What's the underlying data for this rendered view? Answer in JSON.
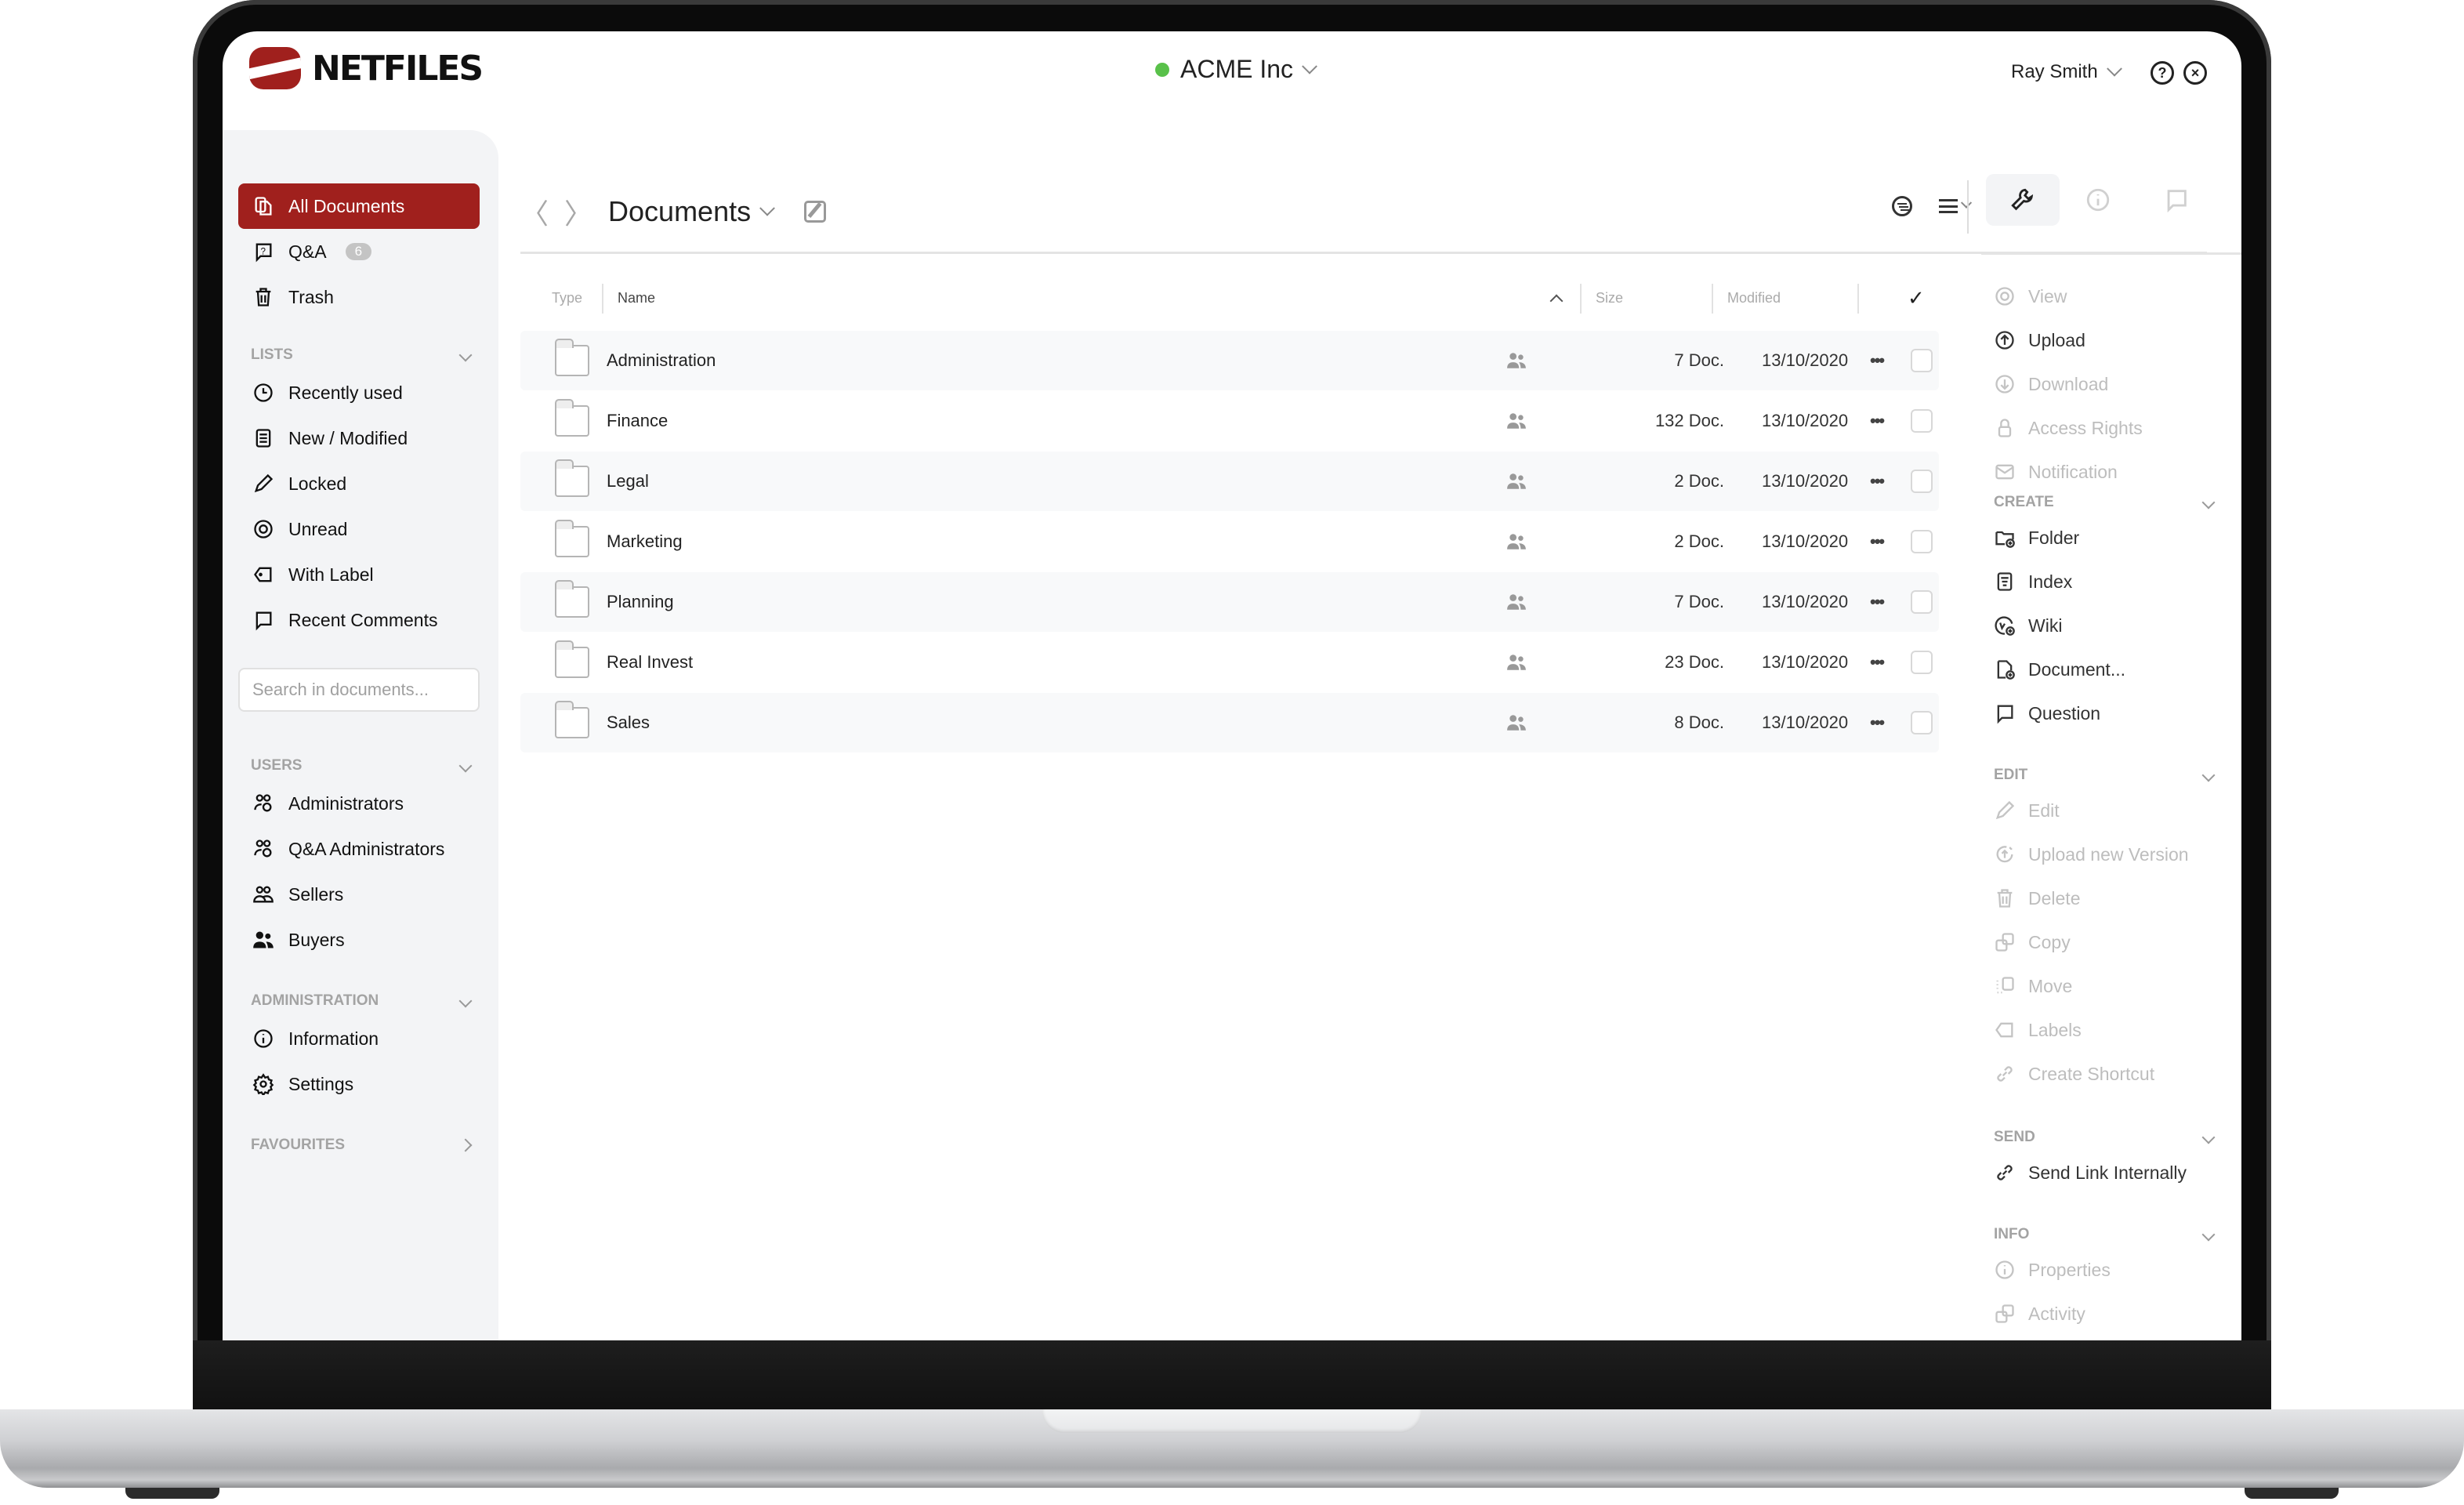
{
  "header": {
    "brand": "NETFILES",
    "organization": "ACME Inc",
    "organization_status_color": "#59c14a",
    "user": "Ray Smith",
    "help_icon": "help-circle-icon",
    "close_icon": "close-circle-icon"
  },
  "sidebar": {
    "top_items": [
      {
        "label": "All Documents",
        "icon": "documents-icon",
        "active": true
      },
      {
        "label": "Q&A",
        "icon": "question-bubble-icon",
        "badge": "6"
      },
      {
        "label": "Trash",
        "icon": "trash-icon"
      }
    ],
    "lists": {
      "title": "LISTS",
      "items": [
        {
          "label": "Recently used",
          "icon": "clock-icon"
        },
        {
          "label": "New / Modified",
          "icon": "document-lines-icon"
        },
        {
          "label": "Locked",
          "icon": "pencil-icon"
        },
        {
          "label": "Unread",
          "icon": "eye-icon"
        },
        {
          "label": "With Label",
          "icon": "tag-icon"
        },
        {
          "label": "Recent Comments",
          "icon": "comment-icon"
        }
      ]
    },
    "search_placeholder": "Search in documents...",
    "users": {
      "title": "USERS",
      "items": [
        {
          "label": "Administrators",
          "icon": "users-gear-icon"
        },
        {
          "label": "Q&A Administrators",
          "icon": "users-gear-icon"
        },
        {
          "label": "Sellers",
          "icon": "users-outline-icon"
        },
        {
          "label": "Buyers",
          "icon": "users-filled-icon"
        }
      ]
    },
    "administration": {
      "title": "ADMINISTRATION",
      "items": [
        {
          "label": "Information",
          "icon": "info-icon"
        },
        {
          "label": "Settings",
          "icon": "gear-icon"
        }
      ]
    },
    "favourites": {
      "title": "FAVOURITES"
    }
  },
  "main": {
    "title": "Documents",
    "columns": {
      "type": "Type",
      "name": "Name",
      "size": "Size",
      "modified": "Modified"
    },
    "rows": [
      {
        "name": "Administration",
        "size": "7 Doc.",
        "modified": "13/10/2020"
      },
      {
        "name": "Finance",
        "size": "132 Doc.",
        "modified": "13/10/2020"
      },
      {
        "name": "Legal",
        "size": "2 Doc.",
        "modified": "13/10/2020"
      },
      {
        "name": "Marketing",
        "size": "2 Doc.",
        "modified": "13/10/2020"
      },
      {
        "name": "Planning",
        "size": "7 Doc.",
        "modified": "13/10/2020"
      },
      {
        "name": "Real Invest",
        "size": "23 Doc.",
        "modified": "13/10/2020"
      },
      {
        "name": "Sales",
        "size": "8 Doc.",
        "modified": "13/10/2020"
      }
    ],
    "more_glyph": "•••"
  },
  "right_panel": {
    "tabs": [
      "tools",
      "info",
      "comments"
    ],
    "actions": [
      {
        "label": "View",
        "icon": "eye-icon",
        "enabled": false
      },
      {
        "label": "Upload",
        "icon": "upload-icon",
        "enabled": true
      },
      {
        "label": "Download",
        "icon": "download-icon",
        "enabled": false
      },
      {
        "label": "Access Rights",
        "icon": "lock-icon",
        "enabled": false
      },
      {
        "label": "Notification",
        "icon": "mail-icon",
        "enabled": false
      }
    ],
    "create": {
      "title": "CREATE",
      "items": [
        {
          "label": "Folder",
          "icon": "folder-plus-icon",
          "enabled": true
        },
        {
          "label": "Index",
          "icon": "index-icon",
          "enabled": true
        },
        {
          "label": "Wiki",
          "icon": "wiki-plus-icon",
          "enabled": true
        },
        {
          "label": "Document...",
          "icon": "document-plus-icon",
          "enabled": true
        },
        {
          "label": "Question",
          "icon": "comment-icon",
          "enabled": true
        }
      ]
    },
    "edit": {
      "title": "EDIT",
      "items": [
        {
          "label": "Edit",
          "icon": "pencil-icon",
          "enabled": false
        },
        {
          "label": "Upload new Version",
          "icon": "upload-version-icon",
          "enabled": false
        },
        {
          "label": "Delete",
          "icon": "trash-icon",
          "enabled": false
        },
        {
          "label": "Copy",
          "icon": "copy-icon",
          "enabled": false
        },
        {
          "label": "Move",
          "icon": "move-icon",
          "enabled": false
        },
        {
          "label": "Labels",
          "icon": "tag-icon",
          "enabled": false
        },
        {
          "label": "Create Shortcut",
          "icon": "link-icon",
          "enabled": false
        }
      ]
    },
    "send": {
      "title": "SEND",
      "items": [
        {
          "label": "Send Link Internally",
          "icon": "link-icon",
          "enabled": true
        }
      ]
    },
    "info": {
      "title": "INFO",
      "items": [
        {
          "label": "Properties",
          "icon": "info-icon",
          "enabled": false
        },
        {
          "label": "Activity",
          "icon": "activity-icon",
          "enabled": false
        }
      ]
    }
  }
}
